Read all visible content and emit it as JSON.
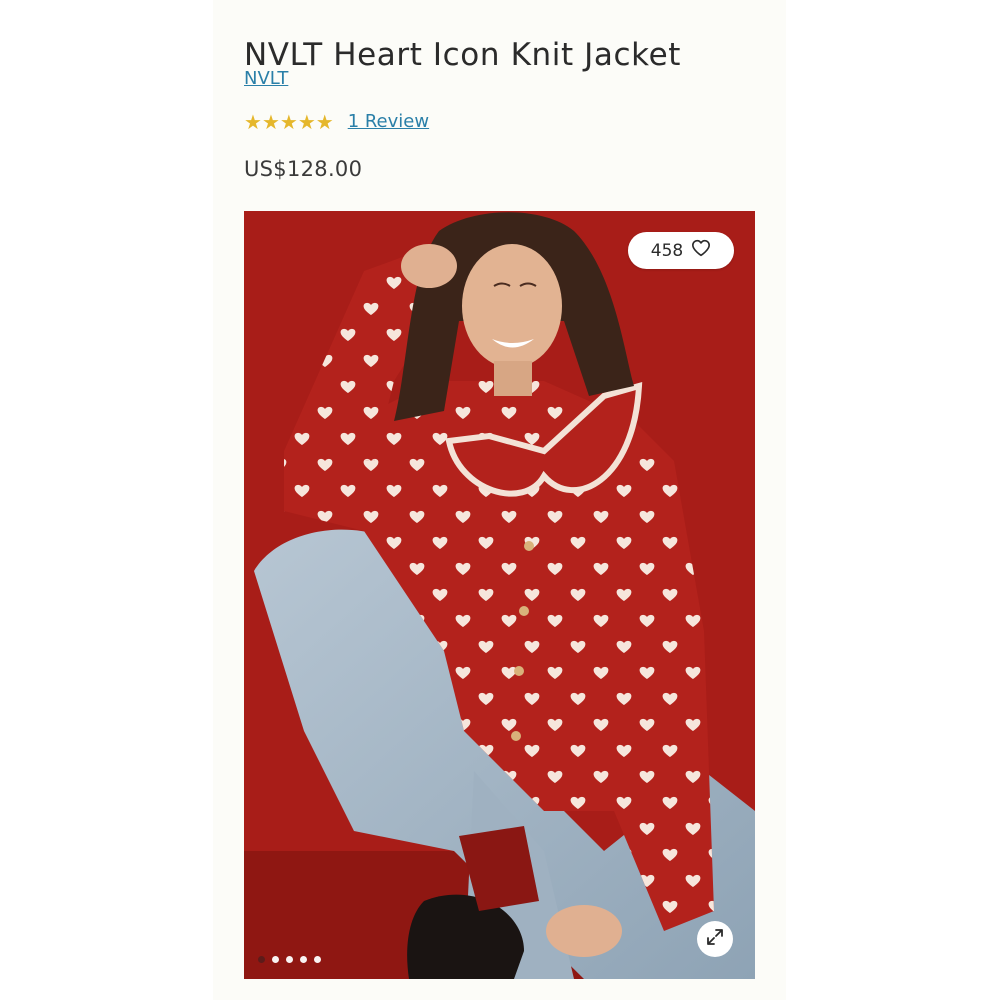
{
  "product": {
    "title": "NVLT Heart Icon Knit Jacket",
    "brand": "NVLT",
    "rating": {
      "stars": 5,
      "star_glyph": "★",
      "star_color": "#e5b72c",
      "reviews_label": "1 Review"
    },
    "price": "US$128.00"
  },
  "gallery": {
    "like_count": "458",
    "like_icon": "heart-outline-icon",
    "expand_icon": "expand-arrows-icon",
    "slide_count": 5,
    "active_slide": 0
  },
  "colors": {
    "link": "#2a7fa8",
    "background_red": "#a81d18",
    "text": "#2b2b2b"
  }
}
